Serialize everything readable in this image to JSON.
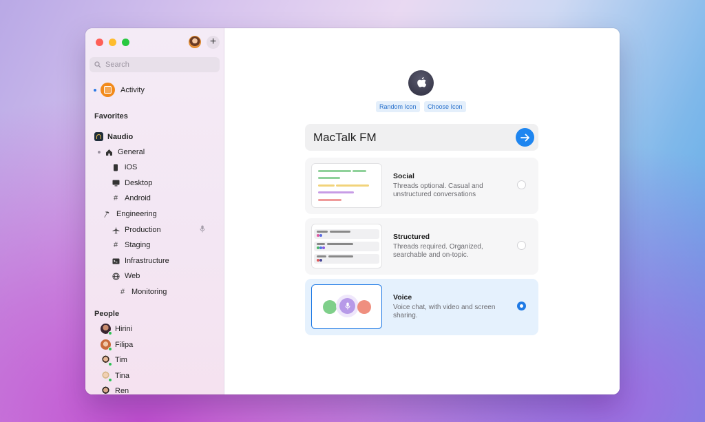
{
  "sidebar": {
    "search_placeholder": "Search",
    "activity_label": "Activity",
    "favorites_heading": "Favorites",
    "workspace": "Naudio",
    "channels": [
      {
        "label": "General",
        "icon": "house-icon"
      },
      {
        "label": "iOS",
        "icon": "phone-icon"
      },
      {
        "label": "Desktop",
        "icon": "monitor-icon"
      },
      {
        "label": "Android",
        "icon": "hash-icon"
      },
      {
        "label": "Engineering",
        "icon": "hammer-icon"
      },
      {
        "label": "Production",
        "icon": "airplane-icon"
      },
      {
        "label": "Staging",
        "icon": "hash-icon"
      },
      {
        "label": "Infrastructure",
        "icon": "terminal-icon"
      },
      {
        "label": "Web",
        "icon": "globe-icon"
      },
      {
        "label": "Monitoring",
        "icon": "hash-icon"
      }
    ],
    "people_heading": "People",
    "people": [
      {
        "name": "Hirini"
      },
      {
        "name": "Filipa"
      },
      {
        "name": "Tim"
      },
      {
        "name": "Tina"
      },
      {
        "name": "Ren"
      }
    ]
  },
  "main": {
    "random_icon_label": "Random Icon",
    "choose_icon_label": "Choose Icon",
    "name_value": "MacTalk FM",
    "options": [
      {
        "title": "Social",
        "description": "Threads optional. Casual and unstructured conversations",
        "selected": false
      },
      {
        "title": "Structured",
        "description": "Threads required. Organized, searchable and on-topic.",
        "selected": false
      },
      {
        "title": "Voice",
        "description": "Voice chat, with video and screen sharing.",
        "selected": true
      }
    ]
  },
  "colors": {
    "accent": "#1f7ae5",
    "activity_orange": "#f28a1a"
  }
}
